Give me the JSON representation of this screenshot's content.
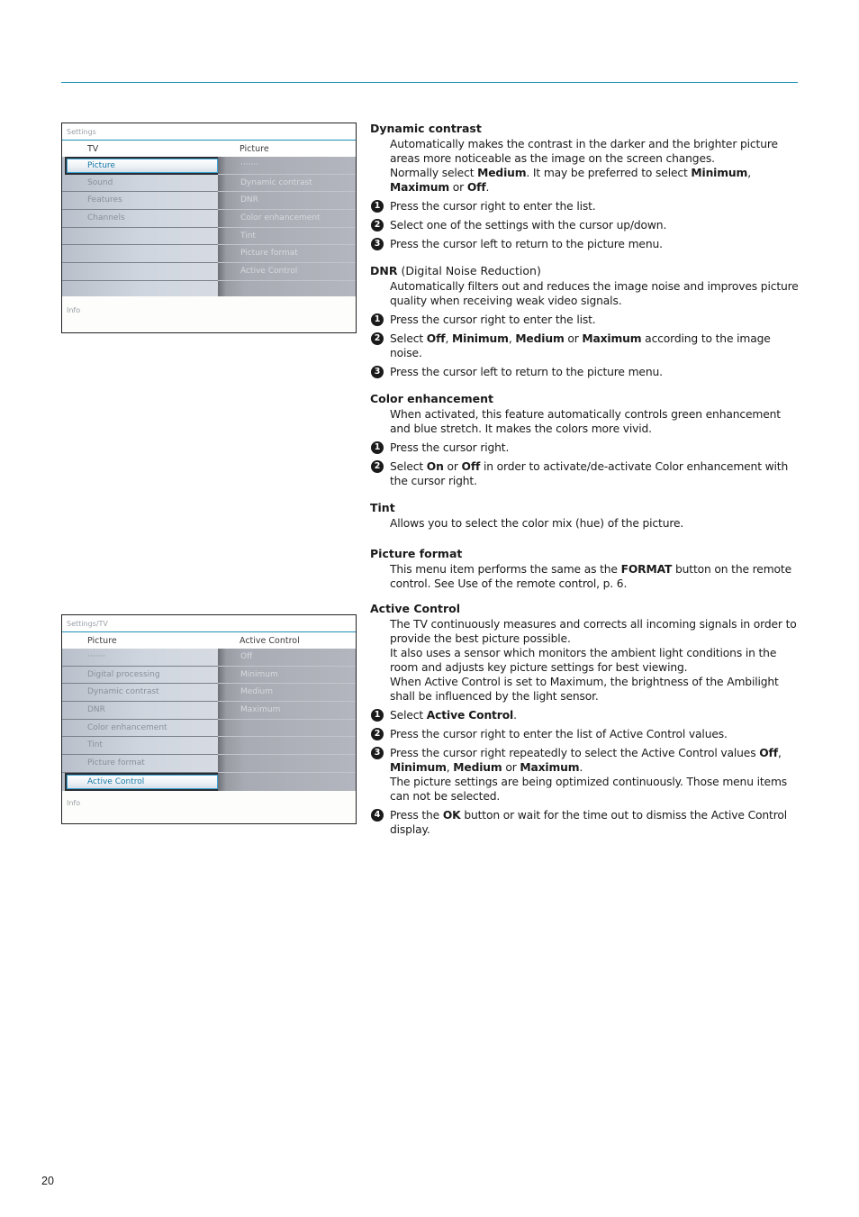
{
  "page": {
    "number": "20",
    "accent_color": "#1e8fb8"
  },
  "menu1": {
    "breadcrumb": "Settings",
    "left_header": "TV",
    "right_header": "Picture",
    "left_items": [
      "Picture",
      "Sound",
      "Features",
      "Channels",
      "",
      "",
      "",
      ""
    ],
    "selected_index": 0,
    "right_items": [
      "·······",
      "Dynamic contrast",
      "DNR",
      "Color enhancement",
      "Tint",
      "Picture format",
      "Active Control",
      ""
    ],
    "info_label": "Info"
  },
  "menu2": {
    "breadcrumb": "Settings/TV",
    "left_header": "Picture",
    "right_header": "Active Control",
    "left_items": [
      "·······",
      "Digital processing",
      "Dynamic contrast",
      "DNR",
      "Color enhancement",
      "Tint",
      "Picture format",
      "Active Control"
    ],
    "selected_index": 7,
    "right_items": [
      "Off",
      "Minimum",
      "Medium",
      "Maximum",
      "",
      "",
      "",
      ""
    ],
    "info_label": "Info"
  },
  "sections": {
    "dynamic_contrast": {
      "title": "Dynamic contrast",
      "p1": "Automatically makes the contrast in the darker and the brighter picture areas more noticeable as the image on the screen changes.",
      "p2_a": "Normally select ",
      "p2_b": "Medium",
      "p2_c": ". It may be preferred to select ",
      "p2_d": "Minimum",
      "p2_e": ", ",
      "p2_f": "Maximum",
      "p2_g": " or ",
      "p2_h": "Off",
      "p2_i": ".",
      "steps": [
        "Press the cursor right to enter the list.",
        "Select one of the settings with the cursor up/down.",
        "Press the cursor left to return to the picture menu."
      ]
    },
    "dnr": {
      "title": "DNR",
      "title_suffix": " (Digital Noise Reduction)",
      "p1": "Automatically filters out and reduces the image noise and improves picture quality when receiving weak video signals.",
      "step1": "Press the cursor right to enter the list.",
      "step2_a": "Select ",
      "step2_b": "Off",
      "step2_c": ", ",
      "step2_d": "Minimum",
      "step2_e": ", ",
      "step2_f": "Medium",
      "step2_g": " or ",
      "step2_h": "Maximum",
      "step2_i": " according to the image noise.",
      "step3": "Press the cursor left to return to the picture menu."
    },
    "color_enhancement": {
      "title": "Color enhancement",
      "p1": "When activated, this feature automatically controls green enhancement and blue stretch. It makes the colors more vivid.",
      "step1": "Press the cursor right.",
      "step2_a": "Select ",
      "step2_b": "On",
      "step2_c": " or ",
      "step2_d": "Off",
      "step2_e": " in order to activate/de-activate Color enhancement with the cursor right."
    },
    "tint": {
      "title": "Tint",
      "p1": "Allows you to select the color mix (hue) of the picture."
    },
    "picture_format": {
      "title": "Picture format",
      "p1_a": "This menu item performs the same as the ",
      "p1_b": "FORMAT",
      "p1_c": " button on the remote control. See Use of the remote control, p. 6."
    },
    "active_control": {
      "title": "Active Control",
      "p1": "The TV continuously measures and corrects all incoming signals in order to provide the best picture possible.",
      "p2": "It also uses a sensor which monitors the ambient light conditions in the room and adjusts key picture settings for best viewing.",
      "p3": "When Active Control is set to Maximum, the brightness of the Ambilight shall be influenced by the light sensor.",
      "step1_a": "Select ",
      "step1_b": "Active Control",
      "step1_c": ".",
      "step2": "Press the cursor right to enter the list of Active Control values.",
      "step3_a": "Press the cursor right repeatedly to select the Active Control values ",
      "step3_b": "Off",
      "step3_c": ", ",
      "step3_d": "Minimum",
      "step3_e": ", ",
      "step3_f": "Medium",
      "step3_g": " or ",
      "step3_h": "Maximum",
      "step3_i": ".",
      "step3_note": "The picture settings are being optimized continuously. Those menu items can not be selected.",
      "step4_a": "Press the ",
      "step4_b": "OK",
      "step4_c": " button or wait for the time out to dismiss the Active Control display."
    }
  },
  "step_numbers": [
    "1",
    "2",
    "3",
    "4"
  ]
}
